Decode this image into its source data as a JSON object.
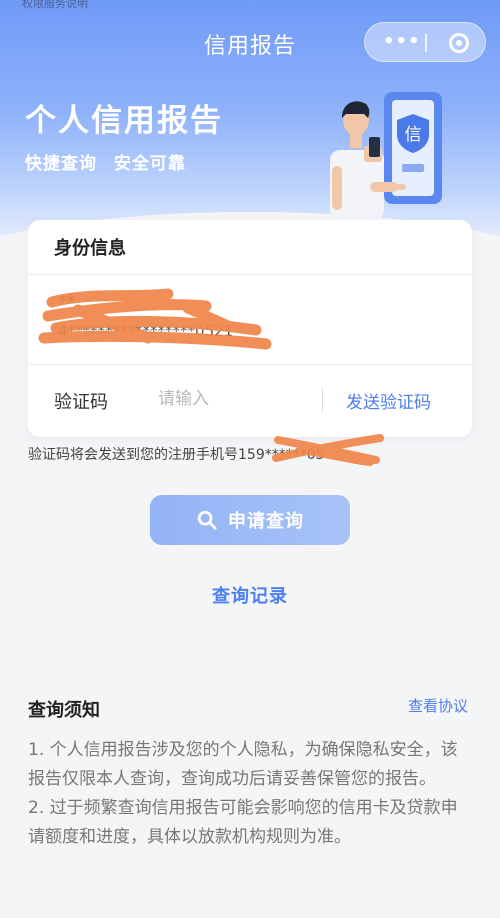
{
  "status_bar": {
    "text": "权限服务说明"
  },
  "nav": {
    "title": "信用报告",
    "more_label": "•••"
  },
  "hero": {
    "title": "个人信用报告",
    "subtitle": "快捷查询 安全可靠",
    "badge_char": "信"
  },
  "identity_card": {
    "header": "身份信息",
    "name": "**",
    "id_number": "4*****************0521"
  },
  "verification": {
    "label": "验证码",
    "placeholder": "请输入",
    "value": "",
    "send_label": "发送验证码"
  },
  "hint": {
    "text": "验证码将会发送到您的注册手机号159******05"
  },
  "apply_button": {
    "label": "申请查询"
  },
  "records_link": {
    "label": "查询记录"
  },
  "notice": {
    "title": "查询须知",
    "link": "查看协议",
    "items": [
      "1. 个人信用报告涉及您的个人隐私，为确保隐私安全，该报告仅限本人查询，查询成功后请妥善保管您的报告。",
      "2. 过于频繁查询信用报告可能会影响您的信用卡及贷款申请额度和进度，具体以放款机构规则为准。"
    ]
  },
  "colors": {
    "accent": "#4d7ef2",
    "header_gradient_top": "#6f9af7",
    "redaction": "#f0844a",
    "button_bg": "#9fbcf7"
  }
}
